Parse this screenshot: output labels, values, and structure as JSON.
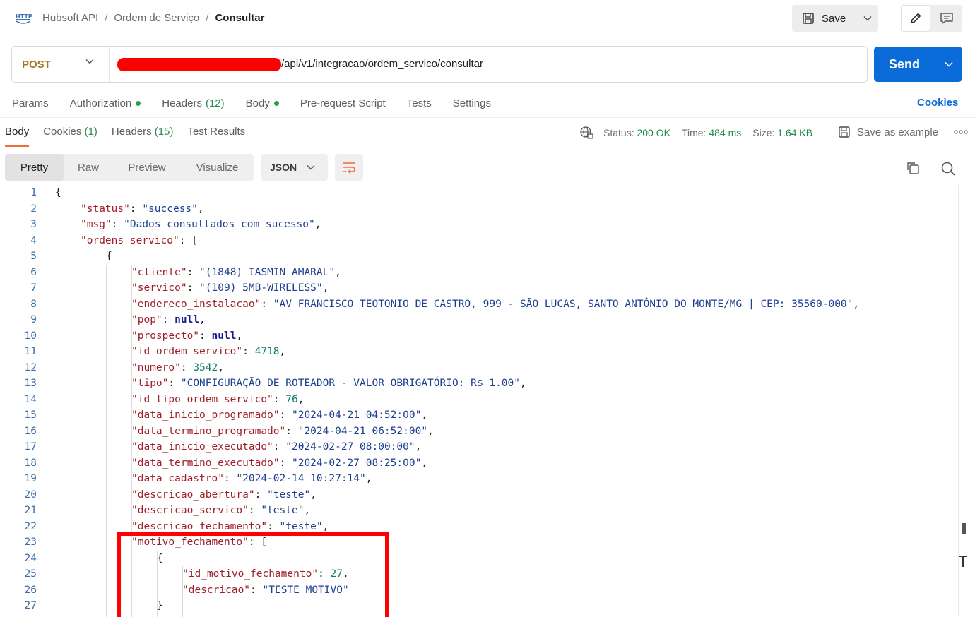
{
  "breadcrumb": {
    "items": [
      "Hubsoft API",
      "Ordem de Serviço",
      "Consultar"
    ],
    "separator": "/"
  },
  "toolbar": {
    "save_label": "Save"
  },
  "request": {
    "method": "POST",
    "url_suffix": "/api/v1/integracao/ordem_servico/consultar",
    "send_label": "Send"
  },
  "request_tabs": [
    {
      "label": "Params",
      "count": "",
      "dot": false
    },
    {
      "label": "Authorization",
      "count": "",
      "dot": true
    },
    {
      "label": "Headers",
      "count": "(12)",
      "dot": false
    },
    {
      "label": "Body",
      "count": "",
      "dot": true
    },
    {
      "label": "Pre-request Script",
      "count": "",
      "dot": false
    },
    {
      "label": "Tests",
      "count": "",
      "dot": false
    },
    {
      "label": "Settings",
      "count": "",
      "dot": false
    }
  ],
  "cookies_link": "Cookies",
  "response_tabs": [
    {
      "label": "Body",
      "count": ""
    },
    {
      "label": "Cookies",
      "count": "(1)"
    },
    {
      "label": "Headers",
      "count": "(15)"
    },
    {
      "label": "Test Results",
      "count": ""
    }
  ],
  "response_meta": {
    "status_label": "Status:",
    "status_value": "200 OK",
    "time_label": "Time:",
    "time_value": "484 ms",
    "size_label": "Size:",
    "size_value": "1.64 KB",
    "save_example": "Save as example"
  },
  "format": {
    "modes": [
      "Pretty",
      "Raw",
      "Preview",
      "Visualize"
    ],
    "active": "Pretty",
    "language": "JSON"
  },
  "code_lines": [
    {
      "n": "1",
      "indent": 0,
      "parts": [
        [
          "p",
          "{"
        ]
      ]
    },
    {
      "n": "2",
      "indent": 1,
      "parts": [
        [
          "k",
          "\"status\""
        ],
        [
          "p",
          ": "
        ],
        [
          "s",
          "\"success\""
        ],
        [
          "p",
          ","
        ]
      ]
    },
    {
      "n": "3",
      "indent": 1,
      "parts": [
        [
          "k",
          "\"msg\""
        ],
        [
          "p",
          ": "
        ],
        [
          "s",
          "\"Dados consultados com sucesso\""
        ],
        [
          "p",
          ","
        ]
      ]
    },
    {
      "n": "4",
      "indent": 1,
      "parts": [
        [
          "k",
          "\"ordens_servico\""
        ],
        [
          "p",
          ": ["
        ]
      ]
    },
    {
      "n": "5",
      "indent": 2,
      "parts": [
        [
          "p",
          "{"
        ]
      ]
    },
    {
      "n": "6",
      "indent": 3,
      "parts": [
        [
          "k",
          "\"cliente\""
        ],
        [
          "p",
          ": "
        ],
        [
          "s",
          "\"(1848) IASMIN AMARAL\""
        ],
        [
          "p",
          ","
        ]
      ]
    },
    {
      "n": "7",
      "indent": 3,
      "parts": [
        [
          "k",
          "\"servico\""
        ],
        [
          "p",
          ": "
        ],
        [
          "s",
          "\"(109) 5MB-WIRELESS\""
        ],
        [
          "p",
          ","
        ]
      ]
    },
    {
      "n": "8",
      "indent": 3,
      "parts": [
        [
          "k",
          "\"endereco_instalacao\""
        ],
        [
          "p",
          ": "
        ],
        [
          "s",
          "\"AV FRANCISCO TEOTONIO DE CASTRO, 999 - SÃO LUCAS, SANTO ANTÔNIO DO MONTE/MG | CEP: 35560-000\""
        ],
        [
          "p",
          ","
        ]
      ]
    },
    {
      "n": "9",
      "indent": 3,
      "parts": [
        [
          "k",
          "\"pop\""
        ],
        [
          "p",
          ": "
        ],
        [
          "kw",
          "null"
        ],
        [
          "p",
          ","
        ]
      ]
    },
    {
      "n": "10",
      "indent": 3,
      "parts": [
        [
          "k",
          "\"prospecto\""
        ],
        [
          "p",
          ": "
        ],
        [
          "kw",
          "null"
        ],
        [
          "p",
          ","
        ]
      ]
    },
    {
      "n": "11",
      "indent": 3,
      "parts": [
        [
          "k",
          "\"id_ordem_servico\""
        ],
        [
          "p",
          ": "
        ],
        [
          "n",
          "4718"
        ],
        [
          "p",
          ","
        ]
      ]
    },
    {
      "n": "12",
      "indent": 3,
      "parts": [
        [
          "k",
          "\"numero\""
        ],
        [
          "p",
          ": "
        ],
        [
          "n",
          "3542"
        ],
        [
          "p",
          ","
        ]
      ]
    },
    {
      "n": "13",
      "indent": 3,
      "parts": [
        [
          "k",
          "\"tipo\""
        ],
        [
          "p",
          ": "
        ],
        [
          "s",
          "\"CONFIGURAÇÃO DE ROTEADOR - VALOR OBRIGATÓRIO: R$ 1.00\""
        ],
        [
          "p",
          ","
        ]
      ]
    },
    {
      "n": "14",
      "indent": 3,
      "parts": [
        [
          "k",
          "\"id_tipo_ordem_servico\""
        ],
        [
          "p",
          ": "
        ],
        [
          "n",
          "76"
        ],
        [
          "p",
          ","
        ]
      ]
    },
    {
      "n": "15",
      "indent": 3,
      "parts": [
        [
          "k",
          "\"data_inicio_programado\""
        ],
        [
          "p",
          ": "
        ],
        [
          "s",
          "\"2024-04-21 04:52:00\""
        ],
        [
          "p",
          ","
        ]
      ]
    },
    {
      "n": "16",
      "indent": 3,
      "parts": [
        [
          "k",
          "\"data_termino_programado\""
        ],
        [
          "p",
          ": "
        ],
        [
          "s",
          "\"2024-04-21 06:52:00\""
        ],
        [
          "p",
          ","
        ]
      ]
    },
    {
      "n": "17",
      "indent": 3,
      "parts": [
        [
          "k",
          "\"data_inicio_executado\""
        ],
        [
          "p",
          ": "
        ],
        [
          "s",
          "\"2024-02-27 08:00:00\""
        ],
        [
          "p",
          ","
        ]
      ]
    },
    {
      "n": "18",
      "indent": 3,
      "parts": [
        [
          "k",
          "\"data_termino_executado\""
        ],
        [
          "p",
          ": "
        ],
        [
          "s",
          "\"2024-02-27 08:25:00\""
        ],
        [
          "p",
          ","
        ]
      ]
    },
    {
      "n": "19",
      "indent": 3,
      "parts": [
        [
          "k",
          "\"data_cadastro\""
        ],
        [
          "p",
          ": "
        ],
        [
          "s",
          "\"2024-02-14 10:27:14\""
        ],
        [
          "p",
          ","
        ]
      ]
    },
    {
      "n": "20",
      "indent": 3,
      "parts": [
        [
          "k",
          "\"descricao_abertura\""
        ],
        [
          "p",
          ": "
        ],
        [
          "s",
          "\"teste\""
        ],
        [
          "p",
          ","
        ]
      ]
    },
    {
      "n": "21",
      "indent": 3,
      "parts": [
        [
          "k",
          "\"descricao_servico\""
        ],
        [
          "p",
          ": "
        ],
        [
          "s",
          "\"teste\""
        ],
        [
          "p",
          ","
        ]
      ]
    },
    {
      "n": "22",
      "indent": 3,
      "parts": [
        [
          "k",
          "\"descricao_fechamento\""
        ],
        [
          "p",
          ": "
        ],
        [
          "s",
          "\"teste\""
        ],
        [
          "p",
          ","
        ]
      ]
    },
    {
      "n": "23",
      "indent": 3,
      "parts": [
        [
          "k",
          "\"motivo_fechamento\""
        ],
        [
          "p",
          ": ["
        ]
      ]
    },
    {
      "n": "24",
      "indent": 4,
      "parts": [
        [
          "p",
          "{"
        ]
      ]
    },
    {
      "n": "25",
      "indent": 5,
      "parts": [
        [
          "k",
          "\"id_motivo_fechamento\""
        ],
        [
          "p",
          ": "
        ],
        [
          "n",
          "27"
        ],
        [
          "p",
          ","
        ]
      ]
    },
    {
      "n": "26",
      "indent": 5,
      "parts": [
        [
          "k",
          "\"descricao\""
        ],
        [
          "p",
          ": "
        ],
        [
          "s",
          "\"TESTE MOTIVO\""
        ]
      ]
    },
    {
      "n": "27",
      "indent": 4,
      "parts": [
        [
          "p",
          "}"
        ]
      ]
    }
  ],
  "colors": {
    "accent": "#0b6bd9",
    "method": "#a7761a",
    "status_ok": "#1f8a4c",
    "active_tab_underline": "#f26b3a",
    "highlight": "#ff0000"
  }
}
